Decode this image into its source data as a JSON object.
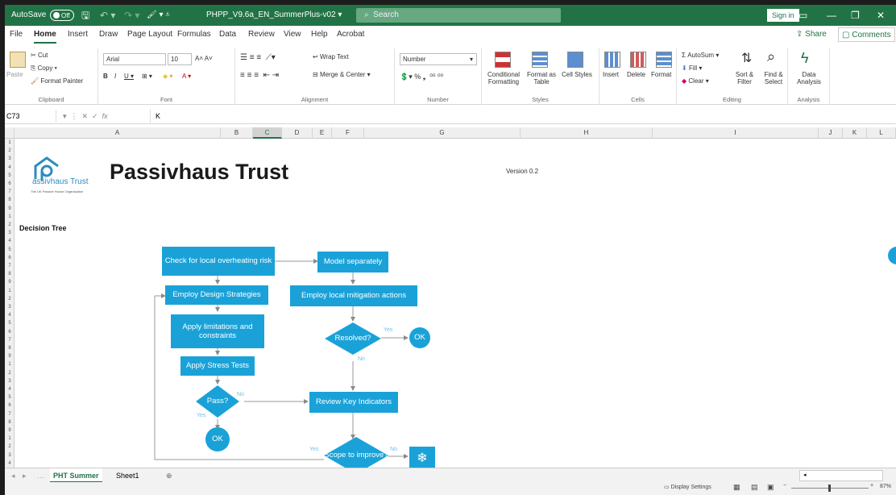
{
  "titlebar": {
    "autosave": "AutoSave",
    "autosave_state": "Off",
    "filename": "PHPP_V9.6a_EN_SummerPlus-v02",
    "search_placeholder": "Search",
    "signin": "Sign in"
  },
  "menu": {
    "tabs": [
      "File",
      "Home",
      "Insert",
      "Draw",
      "Page Layout",
      "Formulas",
      "Data",
      "Review",
      "View",
      "Help",
      "Acrobat"
    ],
    "active": "Home",
    "share": "Share",
    "comments": "Comments"
  },
  "ribbon": {
    "clipboard": {
      "paste": "Paste",
      "cut": "Cut",
      "copy": "Copy",
      "format_painter": "Format Painter",
      "label": "Clipboard"
    },
    "font": {
      "name": "Arial",
      "size": "10",
      "label": "Font"
    },
    "alignment": {
      "wrap": "Wrap Text",
      "merge": "Merge & Center",
      "label": "Alignment"
    },
    "number": {
      "format": "Number",
      "label": "Number"
    },
    "styles": {
      "conditional": "Conditional Formatting",
      "table": "Format as Table",
      "cell": "Cell Styles",
      "label": "Styles"
    },
    "cells": {
      "insert": "Insert",
      "delete": "Delete",
      "format": "Format",
      "label": "Cells"
    },
    "editing": {
      "autosum": "AutoSum",
      "fill": "Fill",
      "clear": "Clear",
      "sort": "Sort & Filter",
      "find": "Find & Select",
      "label": "Editing"
    },
    "analysis": {
      "data": "Data Analysis",
      "label": "Analysis"
    }
  },
  "formula": {
    "namebox": "C73",
    "value": "K"
  },
  "columns": [
    "A",
    "B",
    "C",
    "D",
    "E",
    "F",
    "G",
    "H",
    "I",
    "J",
    "K",
    "L"
  ],
  "selected_column": "C",
  "sheet": {
    "logo_text": "assivhaus Trust",
    "logo_tag": "The UK Passive House Organisation",
    "title": "Passivhaus Trust",
    "version": "Version 0.2",
    "decision_tree": "Decision Tree"
  },
  "flow": {
    "check": "Check for local overheating risk",
    "model": "Model separately",
    "employ_design": "Employ Design Strategies",
    "employ_local": "Employ local mitigation actions",
    "apply_limits": "Apply limitations and constraints",
    "resolved": "Resolved?",
    "ok1": "OK",
    "stress": "Apply Stress Tests",
    "pass": "Pass?",
    "review": "Review Key Indicators",
    "ok2": "OK",
    "scope": "Scope to improve?",
    "yes": "Yes",
    "no": "No",
    "snowflake": "❄"
  },
  "tabs": [
    "PHT Summer",
    "Sheet1"
  ],
  "active_tab": "PHT Summer",
  "status": {
    "display": "Display Settings",
    "zoom": "87%"
  }
}
